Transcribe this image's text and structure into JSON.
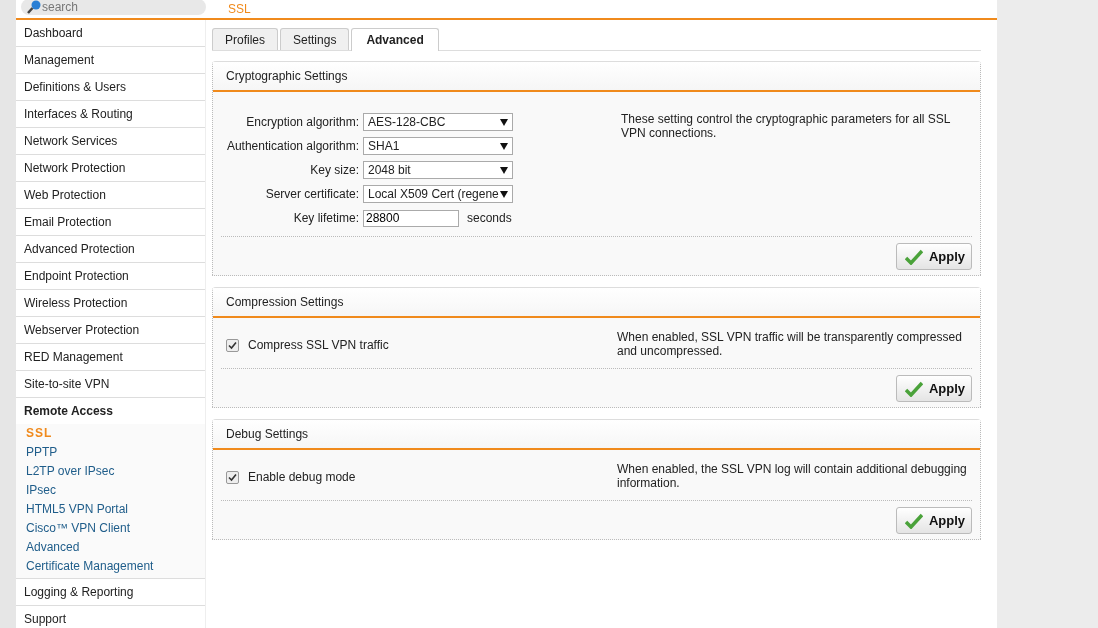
{
  "search": {
    "placeholder": "search"
  },
  "page_title": "SSL",
  "sidebar": {
    "items": [
      {
        "label": "Dashboard",
        "expanded": false
      },
      {
        "label": "Management",
        "expanded": false
      },
      {
        "label": "Definitions & Users",
        "expanded": false
      },
      {
        "label": "Interfaces & Routing",
        "expanded": false
      },
      {
        "label": "Network Services",
        "expanded": false
      },
      {
        "label": "Network Protection",
        "expanded": false
      },
      {
        "label": "Web Protection",
        "expanded": false
      },
      {
        "label": "Email Protection",
        "expanded": false
      },
      {
        "label": "Advanced Protection",
        "expanded": false
      },
      {
        "label": "Endpoint Protection",
        "expanded": false
      },
      {
        "label": "Wireless Protection",
        "expanded": false
      },
      {
        "label": "Webserver Protection",
        "expanded": false
      },
      {
        "label": "RED Management",
        "expanded": false
      },
      {
        "label": "Site-to-site VPN",
        "expanded": false
      },
      {
        "label": "Remote Access",
        "expanded": true,
        "children": [
          {
            "label": "SSL",
            "selected": true
          },
          {
            "label": "PPTP",
            "selected": false
          },
          {
            "label": "L2TP over IPsec",
            "selected": false
          },
          {
            "label": "IPsec",
            "selected": false
          },
          {
            "label": "HTML5 VPN Portal",
            "selected": false
          },
          {
            "label": "Cisco™ VPN Client",
            "selected": false
          },
          {
            "label": "Advanced",
            "selected": false
          },
          {
            "label": "Certificate Management",
            "selected": false
          }
        ]
      },
      {
        "label": "Logging & Reporting",
        "expanded": false
      },
      {
        "label": "Support",
        "expanded": false
      }
    ]
  },
  "tabs": [
    {
      "label": "Profiles",
      "selected": false
    },
    {
      "label": "Settings",
      "selected": false
    },
    {
      "label": "Advanced",
      "selected": true
    }
  ],
  "sections": [
    {
      "kind": "form",
      "title": "Cryptographic Settings",
      "fields": [
        {
          "kind": "select",
          "label": "Encryption algorithm:",
          "value": "AES-128-CBC"
        },
        {
          "kind": "select",
          "label": "Authentication algorithm:",
          "value": "SHA1"
        },
        {
          "kind": "select",
          "label": "Key size:",
          "value": "2048 bit"
        },
        {
          "kind": "select",
          "label": "Server certificate:",
          "value": "Local X509 Cert (regene"
        },
        {
          "kind": "text",
          "label": "Key lifetime:",
          "value": "28800",
          "unit": "seconds"
        }
      ],
      "description": "These setting control the cryptographic parameters for all SSL VPN connections.",
      "button": "Apply"
    },
    {
      "kind": "checkbox",
      "title": "Compression Settings",
      "checkbox": {
        "label": "Compress SSL VPN traffic",
        "checked": true
      },
      "description": "When enabled, SSL VPN traffic will be transparently compressed and uncompressed.",
      "button": "Apply"
    },
    {
      "kind": "checkbox",
      "title": "Debug Settings",
      "checkbox": {
        "label": "Enable debug mode",
        "checked": true
      },
      "description": "When enabled, the SSL VPN log will contain additional debugging information.",
      "button": "Apply"
    }
  ]
}
